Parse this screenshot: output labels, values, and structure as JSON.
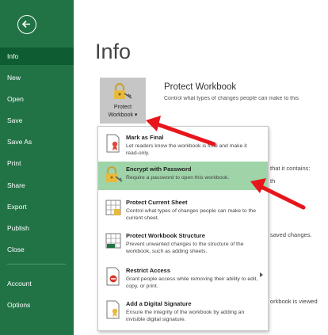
{
  "sidebar": {
    "items": [
      {
        "label": "Info",
        "active": true
      },
      {
        "label": "New"
      },
      {
        "label": "Open"
      },
      {
        "label": "Save"
      },
      {
        "label": "Save As"
      },
      {
        "label": "Print"
      },
      {
        "label": "Share"
      },
      {
        "label": "Export"
      },
      {
        "label": "Publish"
      },
      {
        "label": "Close"
      },
      {
        "label": "Account"
      },
      {
        "label": "Options"
      }
    ]
  },
  "main": {
    "title": "Info",
    "protect_button": {
      "line1": "Protect",
      "line2": "Workbook ▾"
    },
    "protect_title": "Protect Workbook",
    "protect_desc": "Control what types of changes people can make to this",
    "bg_fragments": {
      "contains": "that it contains:",
      "th": "th",
      "saved_changes": "saved changes.",
      "viewed": "orkbook is viewed"
    }
  },
  "menu": {
    "items": [
      {
        "title": "Mark as Final",
        "desc": "Let readers know the workbook is final and make it read-only."
      },
      {
        "title": "Encrypt with Password",
        "desc": "Require a password to open this workbook."
      },
      {
        "title": "Protect Current Sheet",
        "desc": "Control what types of changes people can make to the current sheet."
      },
      {
        "title": "Protect Workbook Structure",
        "desc": "Prevent unwanted changes to the structure of the workbook, such as adding sheets."
      },
      {
        "title": "Restrict Access",
        "desc": "Grant people access while removing their ability to edit, copy, or print."
      },
      {
        "title": "Add a Digital Signature",
        "desc": "Ensure the integrity of the workbook by adding an invisible digital signature."
      }
    ]
  },
  "colors": {
    "sidebar": "#217346",
    "sidebar_active": "#0e5c32",
    "highlight": "#9fd4a8",
    "annotation_arrow": "#e8151b"
  },
  "icons": {
    "back": "back-arrow-icon",
    "protect": "lock-key-icon",
    "mark_final": "ribbon-document-icon",
    "encrypt": "lock-key-icon",
    "protect_sheet": "sheet-lock-icon",
    "protect_structure": "workbook-structure-icon",
    "restrict": "restricted-document-icon",
    "signature": "signature-document-icon"
  }
}
